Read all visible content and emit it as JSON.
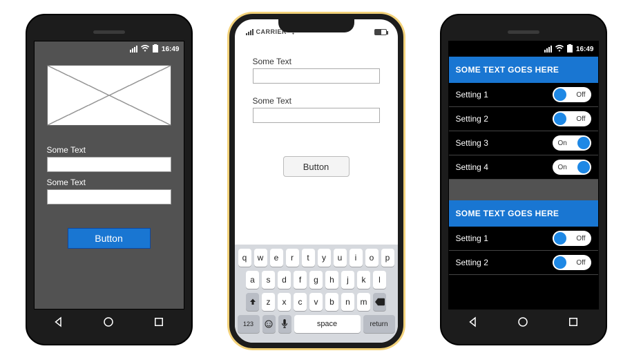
{
  "phone1": {
    "statusbar": {
      "time": "16:49"
    },
    "label1": "Some Text",
    "label2": "Some Text",
    "input1_value": "",
    "input2_value": "",
    "button": "Button",
    "nav": {
      "back": "back",
      "home": "home",
      "recent": "recent"
    }
  },
  "phone2": {
    "statusbar": {
      "carrier": "CARRIER"
    },
    "label1": "Some Text",
    "label2": "Some Text",
    "input1_value": "",
    "input2_value": "",
    "button": "Button",
    "keyboard": {
      "row1": [
        "q",
        "w",
        "e",
        "r",
        "t",
        "y",
        "u",
        "i",
        "o",
        "p"
      ],
      "row2": [
        "a",
        "s",
        "d",
        "f",
        "g",
        "h",
        "j",
        "k",
        "l"
      ],
      "row3": [
        "z",
        "x",
        "c",
        "v",
        "b",
        "n",
        "m"
      ],
      "numKey": "123",
      "space": "space",
      "return": "return"
    }
  },
  "phone3": {
    "statusbar": {
      "time": "16:49"
    },
    "section1": {
      "header": "SOME TEXT GOES HERE",
      "rows": [
        {
          "label": "Setting 1",
          "state": "off",
          "text": "Off"
        },
        {
          "label": "Setting 2",
          "state": "off",
          "text": "Off"
        },
        {
          "label": "Setting 3",
          "state": "on",
          "text": "On"
        },
        {
          "label": "Setting 4",
          "state": "on",
          "text": "On"
        }
      ]
    },
    "section2": {
      "header": "SOME TEXT GOES HERE",
      "rows": [
        {
          "label": "Setting 1",
          "state": "off",
          "text": "Off"
        },
        {
          "label": "Setting 2",
          "state": "off",
          "text": "Off"
        }
      ]
    },
    "nav": {
      "back": "back",
      "home": "home",
      "recent": "recent"
    }
  }
}
